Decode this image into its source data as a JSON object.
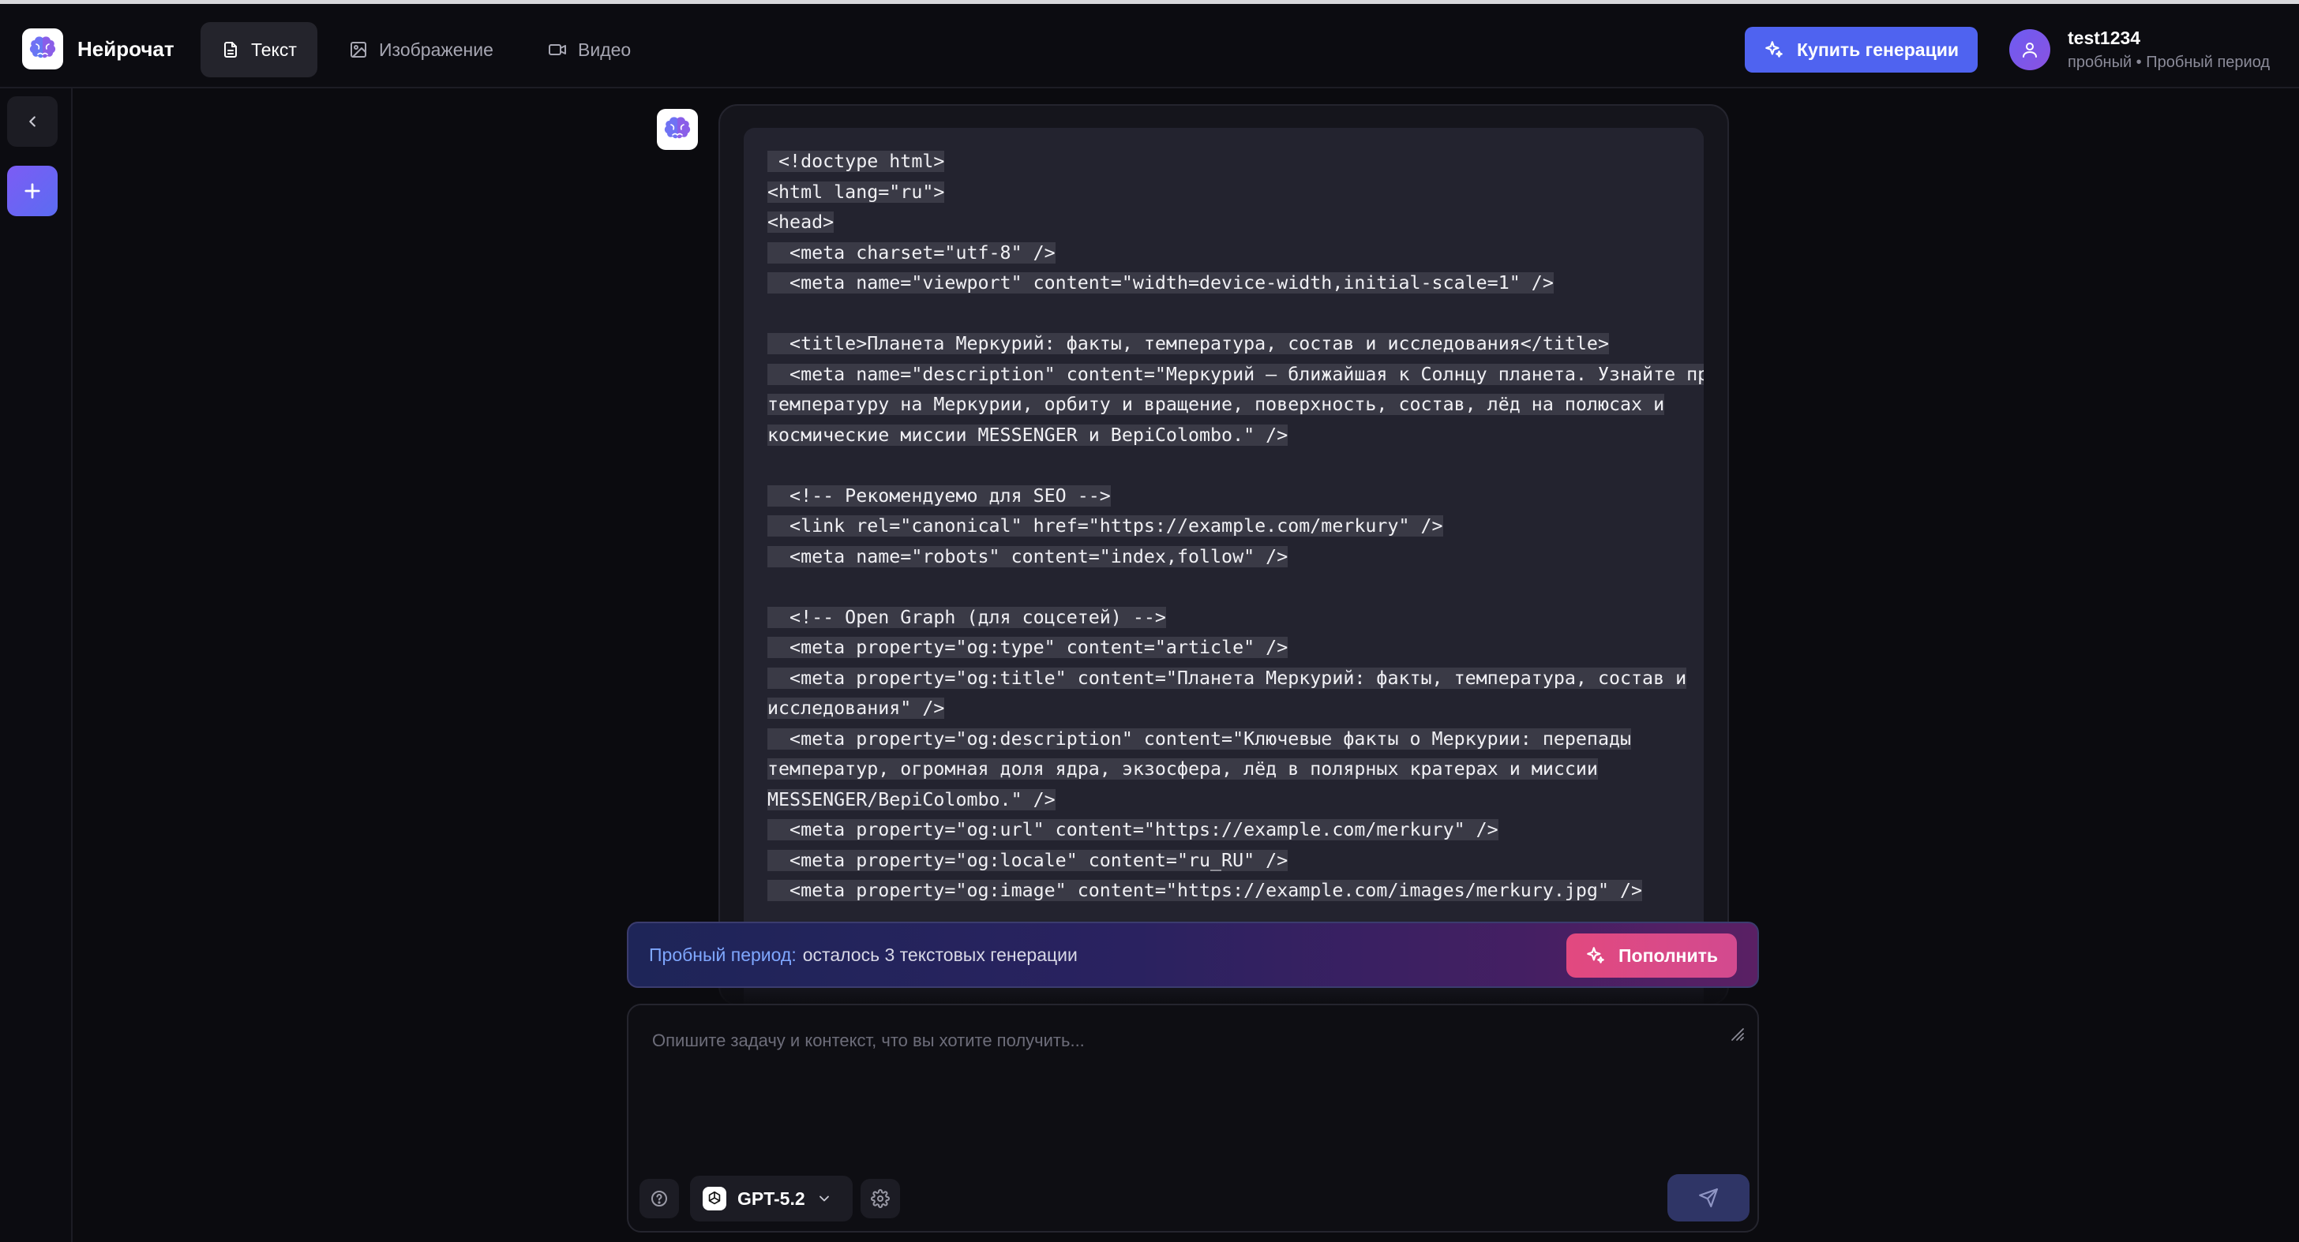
{
  "app": {
    "name": "Нейрочат"
  },
  "nav": {
    "tabs": [
      {
        "label": "Текст",
        "icon": "document-icon",
        "active": true
      },
      {
        "label": "Изображение",
        "icon": "image-icon",
        "active": false
      },
      {
        "label": "Видео",
        "icon": "video-icon",
        "active": false
      }
    ]
  },
  "header": {
    "buy_label": "Купить генерации",
    "user": {
      "name": "test1234",
      "subtitle": "пробный • Пробный период"
    }
  },
  "sidebar": {
    "collapse_icon": "chevron-left-icon",
    "new_chat_icon": "plus-icon"
  },
  "message": {
    "code_lines": [
      " <!doctype html>",
      "<html lang=\"ru\">",
      "<head>",
      "  <meta charset=\"utf-8\" />",
      "  <meta name=\"viewport\" content=\"width=device-width,initial-scale=1\" />",
      "",
      "  <title>Планета Меркурий: факты, температура, состав и исследования</title>",
      "  <meta name=\"description\" content=\"Меркурий — ближайшая к Солнцу планета. Узнайте про",
      "температуру на Меркурии, орбиту и вращение, поверхность, состав, лёд на полюсах и",
      "космические миссии MESSENGER и BepiColombo.\" />",
      "",
      "  <!-- Рекомендуемо для SEO -->",
      "  <link rel=\"canonical\" href=\"https://example.com/merkury\" />",
      "  <meta name=\"robots\" content=\"index,follow\" />",
      "",
      "  <!-- Open Graph (для соцсетей) -->",
      "  <meta property=\"og:type\" content=\"article\" />",
      "  <meta property=\"og:title\" content=\"Планета Меркурий: факты, температура, состав и",
      "исследования\" />",
      "  <meta property=\"og:description\" content=\"Ключевые факты о Меркурии: перепады",
      "температур, огромная доля ядра, экзосфера, лёд в полярных кратерах и миссии",
      "MESSENGER/BepiColombo.\" />",
      "  <meta property=\"og:url\" content=\"https://example.com/merkury\" />",
      "  <meta property=\"og:locale\" content=\"ru_RU\" />",
      "  <meta property=\"og:image\" content=\"https://example.com/images/merkury.jpg\" />"
    ]
  },
  "trial": {
    "label": "Пробный период:",
    "text": "осталось 3 текстовых генерации",
    "topup_label": "Пополнить"
  },
  "composer": {
    "placeholder": "Опишите задачу и контекст, что вы хотите получить...",
    "model": "GPT-5.2"
  },
  "colors": {
    "accent": "#4f63f0",
    "pink": "#e2497f",
    "background": "#0b0b0f"
  }
}
